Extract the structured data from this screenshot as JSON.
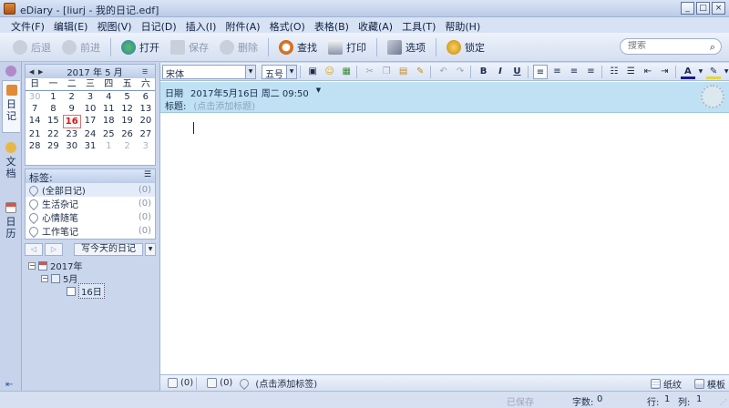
{
  "window": {
    "title": "eDiary - [liurj - 我的日记.edf]",
    "controls": [
      "_",
      "□",
      "×"
    ]
  },
  "menu": [
    "文件(F)",
    "编辑(E)",
    "视图(V)",
    "日记(D)",
    "插入(I)",
    "附件(A)",
    "格式(O)",
    "表格(B)",
    "收藏(A)",
    "工具(T)",
    "帮助(H)"
  ],
  "toolbar": {
    "back": "后退",
    "forward": "前进",
    "open": "打开",
    "save": "保存",
    "delete": "删除",
    "find": "查找",
    "print": "打印",
    "options": "选项",
    "lock": "锁定"
  },
  "search": {
    "placeholder": "搜索"
  },
  "side_tabs": {
    "diary": "日记",
    "docs": "文档",
    "calendar": "日历"
  },
  "calendar": {
    "year": "2017",
    "month": "5",
    "title": "2017 年 5 月",
    "weekdays": [
      "日",
      "一",
      "二",
      "三",
      "四",
      "五",
      "六"
    ],
    "days": [
      [
        "30",
        "1",
        "2",
        "3",
        "4",
        "5",
        "6"
      ],
      [
        "7",
        "8",
        "9",
        "10",
        "11",
        "12",
        "13"
      ],
      [
        "14",
        "15",
        "16",
        "17",
        "18",
        "19",
        "20"
      ],
      [
        "21",
        "22",
        "23",
        "24",
        "25",
        "26",
        "27"
      ],
      [
        "28",
        "29",
        "30",
        "31",
        "1",
        "2",
        "3"
      ]
    ],
    "today": "16"
  },
  "tags": {
    "header": "标签:",
    "items": [
      {
        "label": "(全部日记)",
        "count": "(0)"
      },
      {
        "label": "生活杂记",
        "count": "(0)"
      },
      {
        "label": "心情随笔",
        "count": "(0)"
      },
      {
        "label": "工作笔记",
        "count": "(0)"
      }
    ]
  },
  "nav": {
    "prev": "◁",
    "next": "▷",
    "write_today": "写今天的日记"
  },
  "tree": {
    "year": "2017年",
    "month": "5月",
    "day": "16日"
  },
  "format": {
    "font": "宋体",
    "size": "五号"
  },
  "entry": {
    "date_label": "日期",
    "date_value": "2017年5月16日  周二  09:50",
    "title_label": "标题:",
    "title_placeholder": "(点击添加标题)"
  },
  "bottom": {
    "attach_count": "(0)",
    "comment_count": "(0)",
    "tag_placeholder": "(点击添加标签)",
    "paper": "纸纹",
    "template": "模板"
  },
  "status": {
    "saved": "已保存",
    "chars_label": "字数:",
    "chars": "0",
    "line_label": "行:",
    "line": "1",
    "col_label": "列:",
    "col": "1"
  }
}
